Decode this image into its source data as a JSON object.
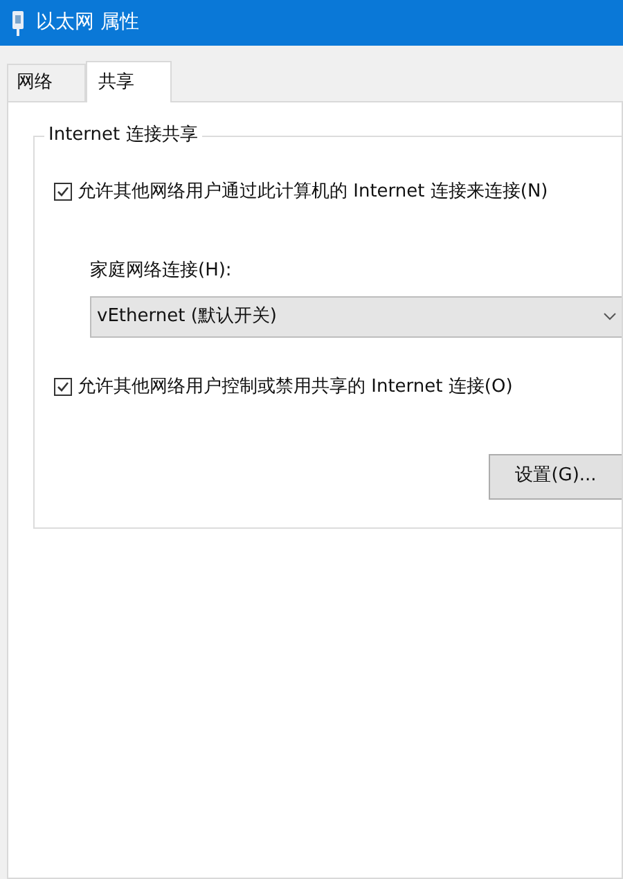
{
  "window": {
    "title": "以太网 属性"
  },
  "tabs": [
    {
      "label": "网络",
      "selected": false
    },
    {
      "label": "共享",
      "selected": true
    }
  ],
  "group": {
    "title": "Internet 连接共享",
    "allow_sharing": {
      "label": "允许其他网络用户通过此计算机的 Internet 连接来连接(N)",
      "checked": true
    },
    "home_network": {
      "label": "家庭网络连接(H):",
      "value": "vEthernet (默认开关)"
    },
    "allow_control": {
      "label": "允许其他网络用户控制或禁用共享的 Internet 连接(O)",
      "checked": true
    },
    "settings_button": "设置(G)..."
  }
}
